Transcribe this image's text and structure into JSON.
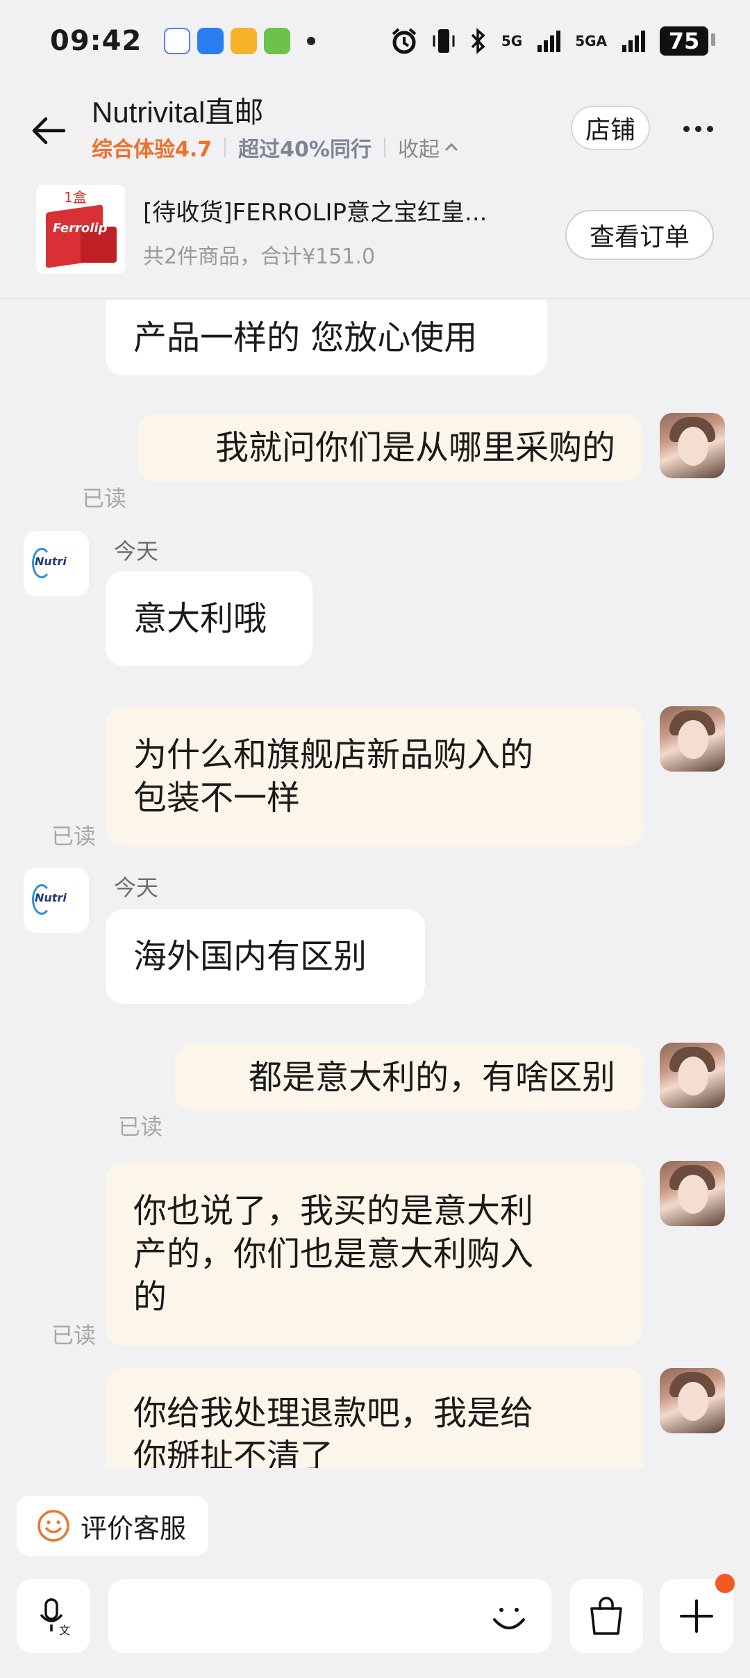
{
  "status_bar": {
    "time": "09:42",
    "network_label": "5G",
    "network2_label": "5GA",
    "battery": "75"
  },
  "header": {
    "shop_name": "Nutrivital直邮",
    "rating": "综合体验4.7",
    "peer_compare": "超过40%同行",
    "collapse_label": "收起",
    "store_button": "店铺",
    "accent_color": "#ef6f2a"
  },
  "order": {
    "thumb_label": "1盒",
    "thumb_brand": "Ferrolip",
    "title": "[待收货]FERROLIP意之宝红皇...",
    "summary": "共2件商品，合计¥151.0",
    "view_button": "查看订单"
  },
  "messages": [
    {
      "side": "left",
      "text": "产品一样的 您放心使用"
    },
    {
      "side": "right",
      "text": "我就问你们是从哪里采购的",
      "read": "已读"
    },
    {
      "side": "left",
      "time": "今天",
      "text": "意大利哦"
    },
    {
      "side": "right",
      "text": "为什么和旗舰店新品购入的包装不一样",
      "line1": "为什么和旗舰店新品购入的",
      "line2": "包装不一样",
      "read": "已读"
    },
    {
      "side": "left",
      "time": "今天",
      "text": "海外国内有区别"
    },
    {
      "side": "right",
      "text": "都是意大利的，有啥区别",
      "read": "已读"
    },
    {
      "side": "right",
      "text": "你也说了，我买的是意大利产的，你们也是意大利购入的",
      "line1": "你也说了，我买的是意大利",
      "line2": "产的，你们也是意大利购入",
      "line3": "的",
      "read": "已读"
    },
    {
      "side": "right",
      "text": "你给我处理退款吧，我是给你掰扯不清了",
      "line1": "你给我处理退款吧，我是给",
      "line2": "你掰扯不清了"
    }
  ],
  "rate_button": "评价客服",
  "input": {
    "placeholder": ""
  }
}
